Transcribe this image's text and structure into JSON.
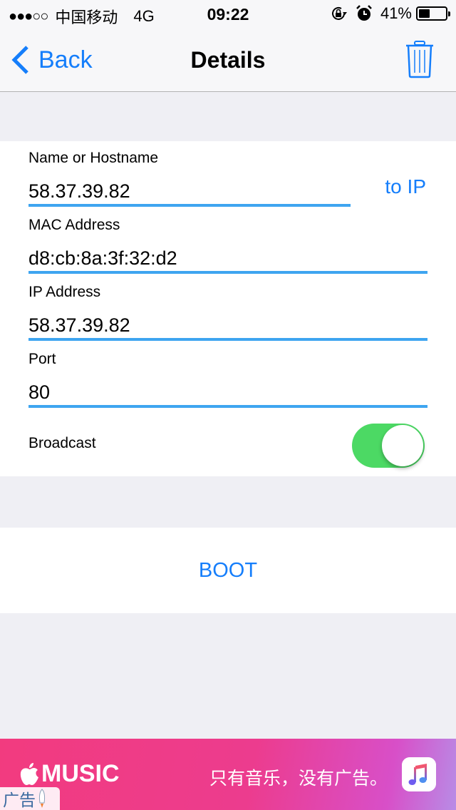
{
  "status_bar": {
    "signal_dots": "●●●○○",
    "carrier": "中国移动",
    "network": "4G",
    "time": "09:22",
    "icons": [
      "rotation-lock-icon",
      "alarm-icon"
    ],
    "battery_percent_label": "41%",
    "battery_level": 0.41
  },
  "nav": {
    "back_label": "Back",
    "title": "Details",
    "right_icon": "trash-icon"
  },
  "form": {
    "hostname": {
      "label": "Name or Hostname",
      "value": "58.37.39.82"
    },
    "to_ip_label": "to IP",
    "mac": {
      "label": "MAC Address",
      "value": "d8:cb:8a:3f:32:d2"
    },
    "ip": {
      "label": "IP Address",
      "value": "58.37.39.82"
    },
    "port": {
      "label": "Port",
      "value": "80"
    },
    "broadcast": {
      "label": "Broadcast",
      "on": true
    }
  },
  "actions": {
    "boot_label": "BOOT"
  },
  "ad": {
    "brand": "MUSIC",
    "slogan": "只有音乐，没有广告。",
    "tag": "广告",
    "colors": {
      "start": "#f23b7f",
      "end": "#b88ce6"
    }
  },
  "colors": {
    "accent": "#157efb",
    "underline": "#3ea5f0",
    "toggle_on": "#4cd964",
    "background": "#efeff4"
  }
}
